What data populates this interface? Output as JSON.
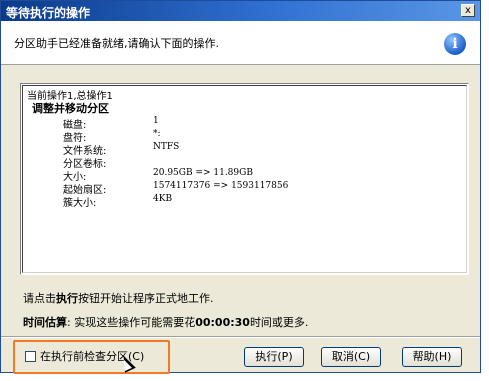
{
  "window": {
    "title": "等待执行的操作",
    "close_glyph": "x"
  },
  "header": {
    "message": "分区助手已经准备就绪,请确认下面的操作.",
    "icon": "info-icon"
  },
  "operations": {
    "summary": "当前操作1,总操作1",
    "title": "调整并移动分区",
    "rows": [
      {
        "label": "磁盘:",
        "value": "1"
      },
      {
        "label": "盘符:",
        "value": "*:"
      },
      {
        "label": "文件系统:",
        "value": "NTFS"
      },
      {
        "label": "分区卷标:",
        "value": ""
      },
      {
        "label": "大小:",
        "value": "20.95GB => 11.89GB"
      },
      {
        "label": "起始扇区:",
        "value": "1574117376 => 1593117856"
      },
      {
        "label": "簇大小:",
        "value": "4KB"
      }
    ]
  },
  "instruction": {
    "prefix": "请点击",
    "bold": "执行",
    "suffix": "按钮开始让程序正式地工作."
  },
  "time_estimate": {
    "label": "时间估算",
    "text": ": 实现这些操作可能需要花",
    "duration": "00:00:30",
    "suffix": "时间或更多."
  },
  "footer": {
    "check_label": "在执行前检查分区(C)",
    "execute_label": "执行(P)",
    "cancel_label": "取消(C)",
    "help_label": "帮助(H)"
  }
}
